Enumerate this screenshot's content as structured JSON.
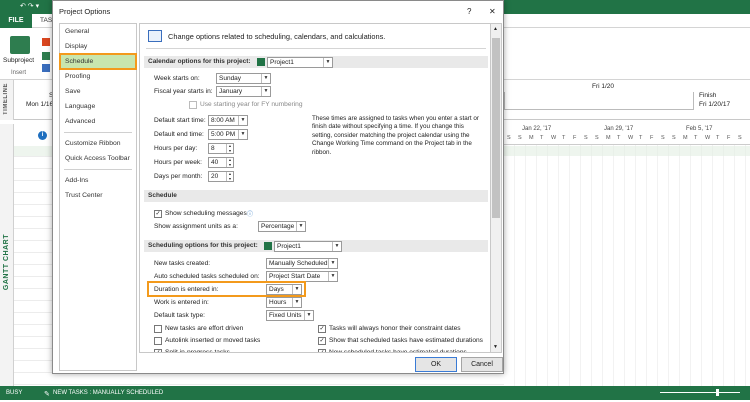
{
  "app": {
    "file_tab": "FILE",
    "ribbon_tab_partial": "TAS",
    "subproject_label": "Subproject",
    "insert_group": "Insert",
    "quick_access": "↶ ↷ ▾"
  },
  "timeline": {
    "label": "TIMELINE",
    "start_partial": "St",
    "start_date": "Mon 1/16",
    "marker_date": "Fri 1/20",
    "finish_label": "Finish",
    "finish_date": "Fri 1/20/17"
  },
  "gantt": {
    "label": "GANTT CHART",
    "row_number": "1",
    "weeks": [
      "Jan 22, '17",
      "Jan 29, '17",
      "Feb 5, '17"
    ],
    "days": [
      "S",
      "S",
      "M",
      "T",
      "W",
      "T",
      "F",
      "S",
      "S",
      "M",
      "T",
      "W",
      "T",
      "F",
      "S",
      "S",
      "M",
      "T",
      "W",
      "T",
      "F",
      "S"
    ]
  },
  "status_bar": {
    "ready": "BUSY",
    "new_tasks": "NEW TASKS : MANUALLY SCHEDULED"
  },
  "dialog": {
    "title": "Project Options",
    "help": "?",
    "close": "✕",
    "nav": [
      {
        "label": "General"
      },
      {
        "label": "Display"
      },
      {
        "label": "Schedule",
        "selected": true
      },
      {
        "label": "Proofing"
      },
      {
        "label": "Save"
      },
      {
        "label": "Language"
      },
      {
        "label": "Advanced"
      },
      {
        "label": "Customize Ribbon"
      },
      {
        "label": "Quick Access Toolbar"
      },
      {
        "label": "Add-Ins"
      },
      {
        "label": "Trust Center"
      }
    ],
    "header_text": "Change options related to scheduling, calendars, and calculations.",
    "calendar": {
      "section": "Calendar options for this project:",
      "project": "Project1",
      "week_starts_label": "Week starts on:",
      "week_starts_value": "Sunday",
      "fiscal_label": "Fiscal year starts in:",
      "fiscal_value": "January",
      "fy_numbering": "Use starting year for FY numbering",
      "start_time_label": "Default start time:",
      "start_time_value": "8:00 AM",
      "end_time_label": "Default end time:",
      "end_time_value": "5:00 PM",
      "hours_day_label": "Hours per day:",
      "hours_day_value": "8",
      "hours_week_label": "Hours per week:",
      "hours_week_value": "40",
      "days_month_label": "Days per month:",
      "days_month_value": "20",
      "note": "These times are assigned to tasks when you enter a start or finish date without specifying a time. If you change this setting, consider matching the project calendar using the Change Working Time command on the Project tab in the ribbon."
    },
    "schedule": {
      "section": "Schedule",
      "show_messages": "Show scheduling messages",
      "units_label": "Show assignment units as a:",
      "units_value": "Percentage"
    },
    "sched_options": {
      "section": "Scheduling options for this project:",
      "project": "Project1",
      "new_tasks_label": "New tasks created:",
      "new_tasks_value": "Manually Scheduled",
      "auto_label": "Auto scheduled tasks scheduled on:",
      "auto_value": "Project Start Date",
      "duration_label": "Duration is entered in:",
      "duration_value": "Days",
      "work_label": "Work is entered in:",
      "work_value": "Hours",
      "task_type_label": "Default task type:",
      "task_type_value": "Fixed Units",
      "checks_left": [
        {
          "label": "New tasks are effort driven",
          "checked": false
        },
        {
          "label": "Autolink inserted or moved tasks",
          "checked": false
        },
        {
          "label": "Split in-progress tasks",
          "checked": true
        }
      ],
      "checks_right": [
        {
          "label": "Tasks will always honor their constraint dates",
          "checked": true
        },
        {
          "label": "Show that scheduled tasks have estimated durations",
          "checked": true
        },
        {
          "label": "New scheduled tasks have estimated durations",
          "checked": true
        }
      ]
    },
    "ok": "OK",
    "cancel": "Cancel",
    "colors": {
      "accent": "#217346",
      "highlight": "#f39a1c",
      "selected_nav": "#c8e6ae"
    }
  }
}
